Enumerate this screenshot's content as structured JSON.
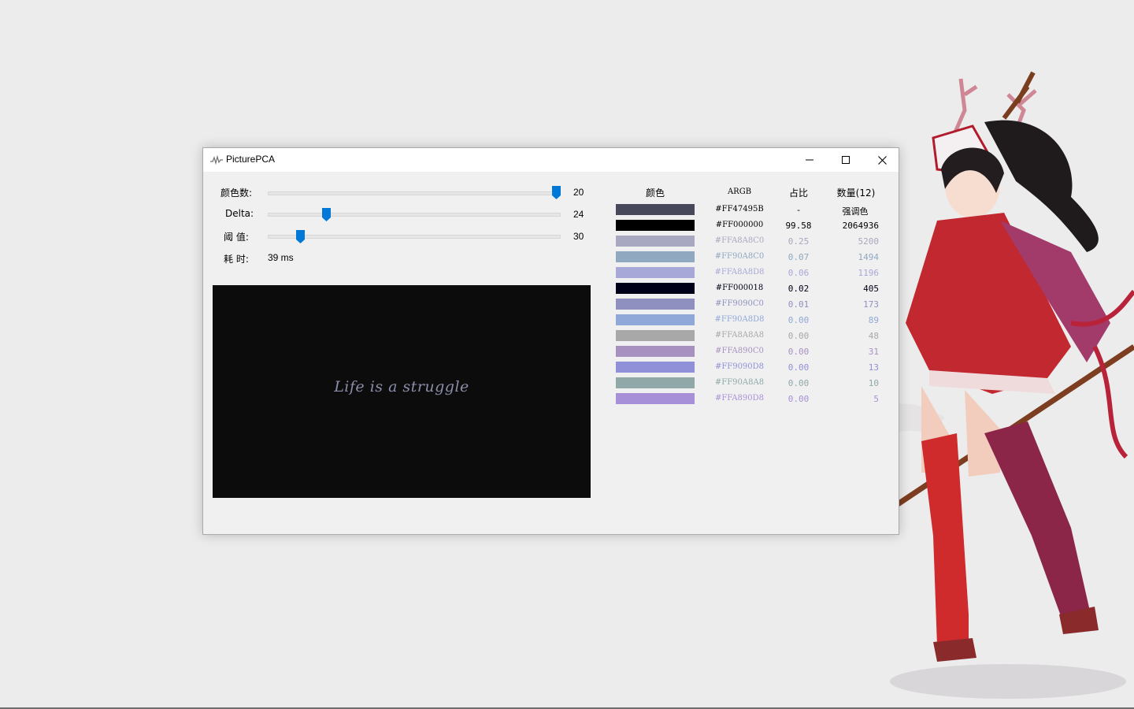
{
  "window": {
    "title": "PicturePCA"
  },
  "controls": {
    "color_count": {
      "label": "颜色数:",
      "value": "20",
      "fraction": 1.0
    },
    "delta": {
      "label": "Delta:",
      "value": "24",
      "fraction": 0.19
    },
    "threshold": {
      "label": "阈 值:",
      "value": "30",
      "fraction": 0.1
    },
    "elapsed": {
      "label": "耗 时:",
      "value": "39 ms"
    }
  },
  "preview": {
    "text": "Life is a struggle"
  },
  "table": {
    "headers": {
      "color": "颜色",
      "argb": "ARGB",
      "ratio": "占比",
      "count": "数量(12)"
    },
    "rows": [
      {
        "swatch": "#47495B",
        "argb": "#FF47495B",
        "ratio": "-",
        "count": "强调色",
        "text_color": "#000000"
      },
      {
        "swatch": "#000000",
        "argb": "#FF000000",
        "ratio": "99.58",
        "count": "2064936",
        "text_color": "#000000"
      },
      {
        "swatch": "#A8A8C0",
        "argb": "#FFA8A8C0",
        "ratio": "0.25",
        "count": "5200",
        "text_color": "#A8A8C0"
      },
      {
        "swatch": "#90A8C0",
        "argb": "#FF90A8C0",
        "ratio": "0.07",
        "count": "1494",
        "text_color": "#90A8C0"
      },
      {
        "swatch": "#A8A8D8",
        "argb": "#FFA8A8D8",
        "ratio": "0.06",
        "count": "1196",
        "text_color": "#A8A8D8"
      },
      {
        "swatch": "#000018",
        "argb": "#FF000018",
        "ratio": "0.02",
        "count": "405",
        "text_color": "#000018"
      },
      {
        "swatch": "#9090C0",
        "argb": "#FF9090C0",
        "ratio": "0.01",
        "count": "173",
        "text_color": "#9090C0"
      },
      {
        "swatch": "#90A8D8",
        "argb": "#FF90A8D8",
        "ratio": "0.00",
        "count": "89",
        "text_color": "#90A8D8"
      },
      {
        "swatch": "#A8A8A8",
        "argb": "#FFA8A8A8",
        "ratio": "0.00",
        "count": "48",
        "text_color": "#A8A8A8"
      },
      {
        "swatch": "#A890C0",
        "argb": "#FFA890C0",
        "ratio": "0.00",
        "count": "31",
        "text_color": "#A890C0"
      },
      {
        "swatch": "#9090D8",
        "argb": "#FF9090D8",
        "ratio": "0.00",
        "count": "13",
        "text_color": "#9090D8"
      },
      {
        "swatch": "#90A8A8",
        "argb": "#FF90A8A8",
        "ratio": "0.00",
        "count": "10",
        "text_color": "#90A8A8"
      },
      {
        "swatch": "#A890D8",
        "argb": "#FFA890D8",
        "ratio": "0.00",
        "count": "5",
        "text_color": "#A890D8"
      }
    ]
  },
  "colors": {
    "slider_accent": "#0078d7",
    "desktop": "#ececec"
  },
  "icons": {
    "app": "waveform-icon",
    "minimize": "minimize-icon",
    "maximize": "maximize-icon",
    "close": "close-icon"
  }
}
